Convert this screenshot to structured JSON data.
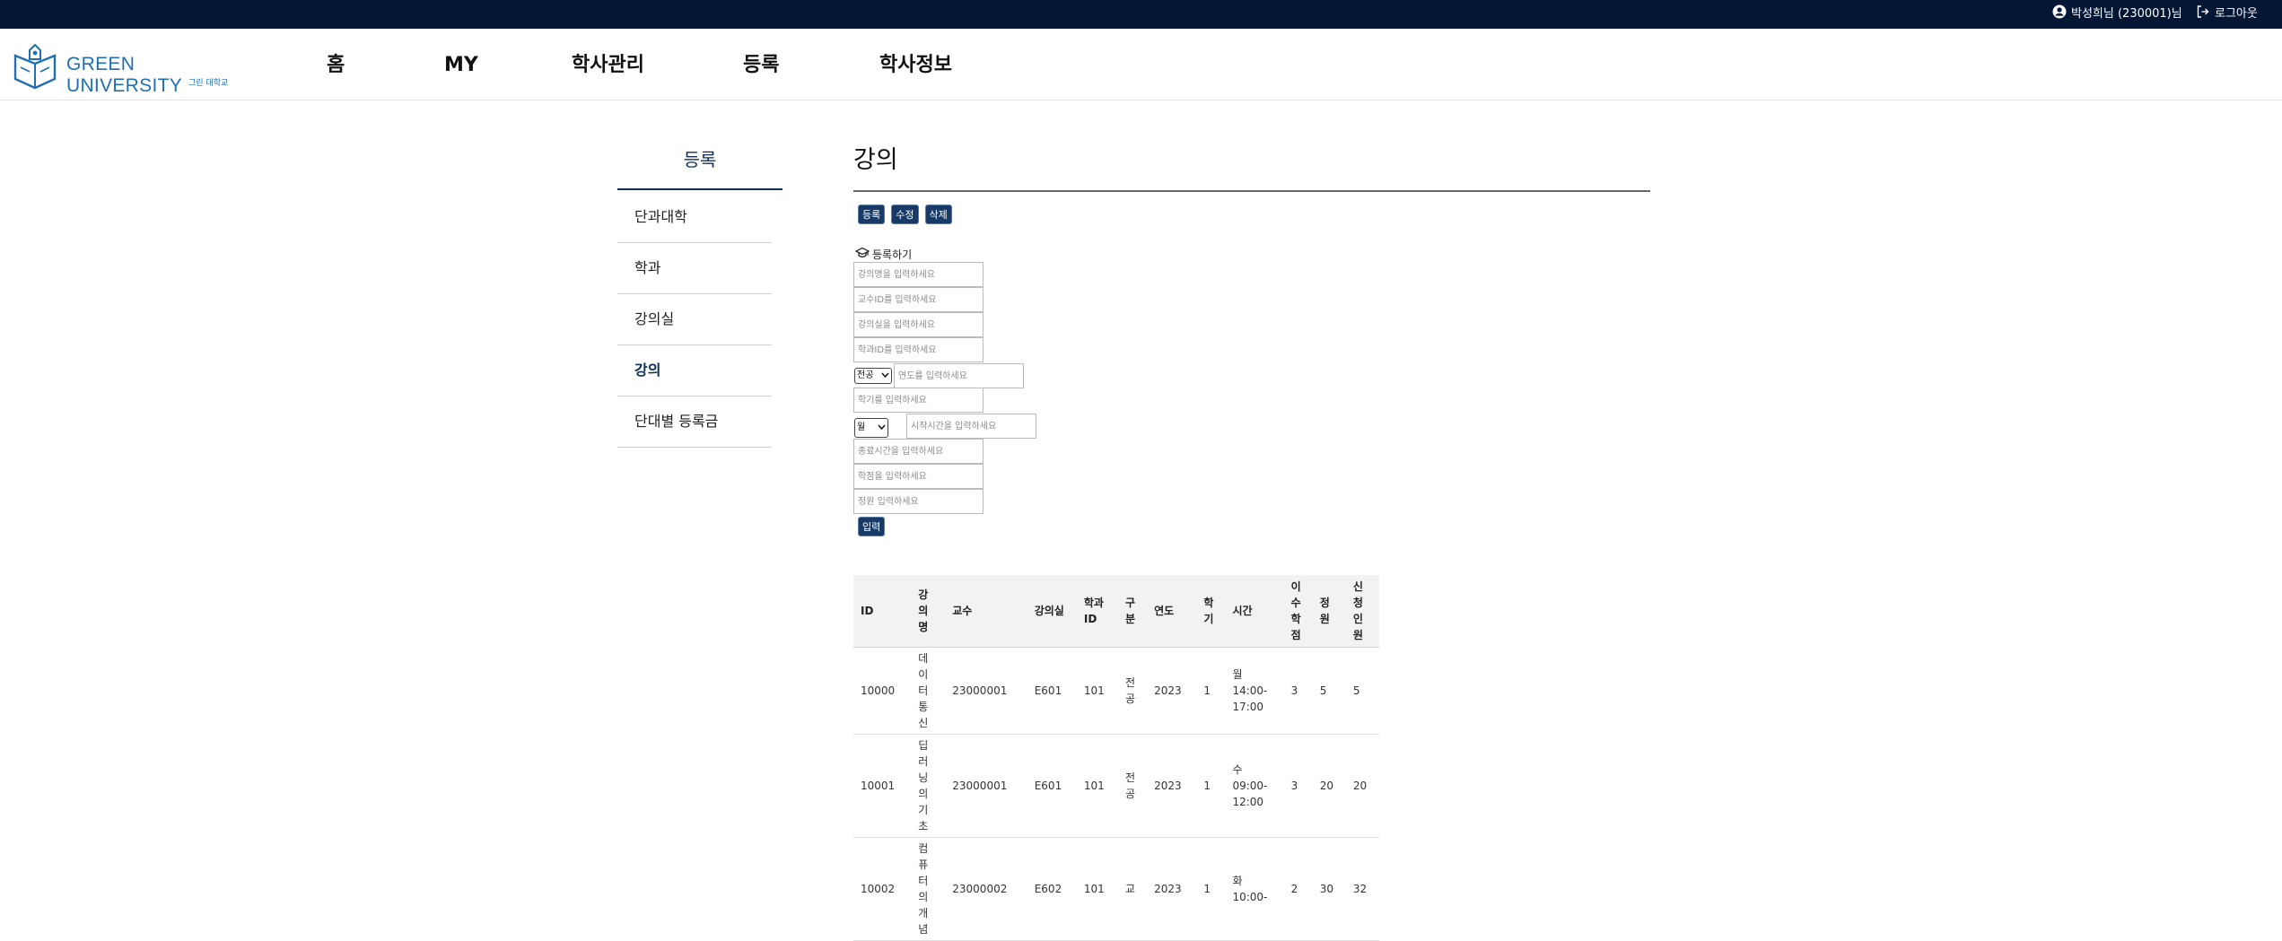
{
  "topbar": {
    "user_label": "박성희님 (230001)님",
    "logout_label": "로그아웃"
  },
  "logo": {
    "wordmark": "GREEN UNIVERSITY",
    "subtitle": "그린 대학교"
  },
  "nav": [
    "홈",
    "MY",
    "학사관리",
    "등록",
    "학사정보"
  ],
  "sidebar": {
    "title": "등록",
    "items": [
      "단과대학",
      "학과",
      "강의실",
      "강의",
      "단대별 등록금"
    ],
    "active": "강의"
  },
  "main": {
    "title": "강의",
    "buttons": [
      "등록",
      "수정",
      "삭제"
    ],
    "form_label": "등록하기",
    "placeholders": {
      "name": "강의명을 입력하세요",
      "prof": "교수ID를 입력하세요",
      "room": "강의실을 입력하세요",
      "dept": "학과ID를 입력하세요",
      "year": "연도를 입력하세요",
      "semester": "학기를 입력하세요",
      "start": "시작시간을 입력하세요",
      "end": "종료시간을 입력하세요",
      "credit": "학점을 입력하세요",
      "capacity": "정원 입력하세요"
    },
    "type_select": "전공",
    "day_select": "월",
    "submit": "입력"
  },
  "table": {
    "headers": [
      "ID",
      "강의명",
      "교수",
      "강의실",
      "학과ID",
      "구분",
      "연도",
      "학기",
      "시간",
      "이수학점",
      "정원",
      "신청인원"
    ],
    "rows": [
      [
        "10000",
        "데이터통신",
        "23000001",
        "E601",
        "101",
        "전공",
        "2023",
        "1",
        "월 14:00-17:00",
        "3",
        "5",
        "5"
      ],
      [
        "10001",
        "딥러닝의 기초",
        "23000001",
        "E601",
        "101",
        "전공",
        "2023",
        "1",
        "수 09:00-12:00",
        "3",
        "20",
        "20"
      ],
      [
        "10002",
        "컴퓨터의 개념",
        "23000002",
        "E602",
        "101",
        "교",
        "2023",
        "1",
        "화 10:00-",
        "2",
        "30",
        "32"
      ]
    ]
  },
  "colors": {
    "topbar": "#031633",
    "brand": "#1f6fb2",
    "accent": "#173a66"
  }
}
